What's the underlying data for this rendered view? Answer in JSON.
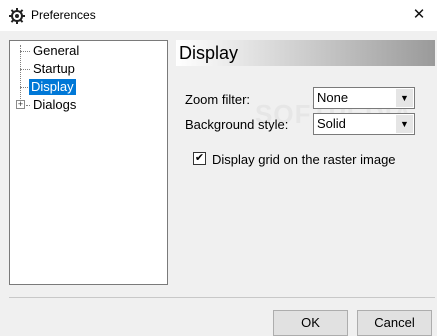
{
  "window": {
    "title": "Preferences",
    "close_glyph": "✕",
    "icon": "gear-icon"
  },
  "tree": {
    "items": [
      {
        "label": "General",
        "selected": false,
        "expandable": false
      },
      {
        "label": "Startup",
        "selected": false,
        "expandable": false
      },
      {
        "label": "Display",
        "selected": true,
        "expandable": false
      },
      {
        "label": "Dialogs",
        "selected": false,
        "expandable": true
      }
    ],
    "expander_glyph": "+"
  },
  "panel": {
    "title": "Display",
    "zoom_filter": {
      "label": "Zoom filter:",
      "value": "None"
    },
    "background_style": {
      "label": "Background style:",
      "value": "Solid"
    },
    "grid_checkbox": {
      "label": "Display grid on the raster image",
      "checked": true,
      "mark": "✔"
    },
    "dropdown_arrow": "▼"
  },
  "watermark": "SOFTPEDIA",
  "buttons": {
    "ok": "OK",
    "cancel": "Cancel"
  },
  "colors": {
    "selection": "#0078d7",
    "window_bg": "#f0f0f0"
  }
}
